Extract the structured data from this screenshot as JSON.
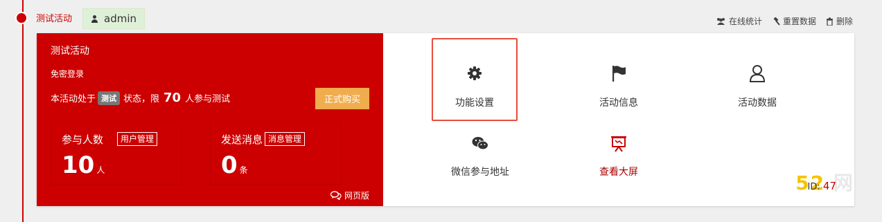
{
  "activity": {
    "name": "测试活动",
    "owner": "admin"
  },
  "top_actions": {
    "online": "在线统计",
    "reset": "重置数据",
    "delete": "删除"
  },
  "panel": {
    "title": "测试活动",
    "login": "免密登录",
    "status_prefix": "本活动处于",
    "status_tag": "测试",
    "status_mid": "状态，限",
    "limit": "70",
    "status_suffix": "人参与测试",
    "buy_label": "正式购买",
    "participants_label": "参与人数",
    "participants_link": "用户管理",
    "participants_value": "10",
    "participants_unit": "人",
    "messages_label": "发送消息",
    "messages_link": "消息管理",
    "messages_value": "0",
    "messages_unit": "条",
    "web_link": "网页版"
  },
  "menu": {
    "settings": "功能设置",
    "info": "活动信息",
    "data": "活动数据",
    "wechat": "微信参与地址",
    "screen": "查看大屏"
  },
  "footer": {
    "watermark_a": "52",
    "watermark_b": "网",
    "id_label": "ID:",
    "id_value": "47"
  },
  "colors": {
    "brand_red": "#cc0000",
    "buy_orange": "#f0ad4e",
    "badge_green": "#dff0d8",
    "highlight": "#e74c3c"
  }
}
